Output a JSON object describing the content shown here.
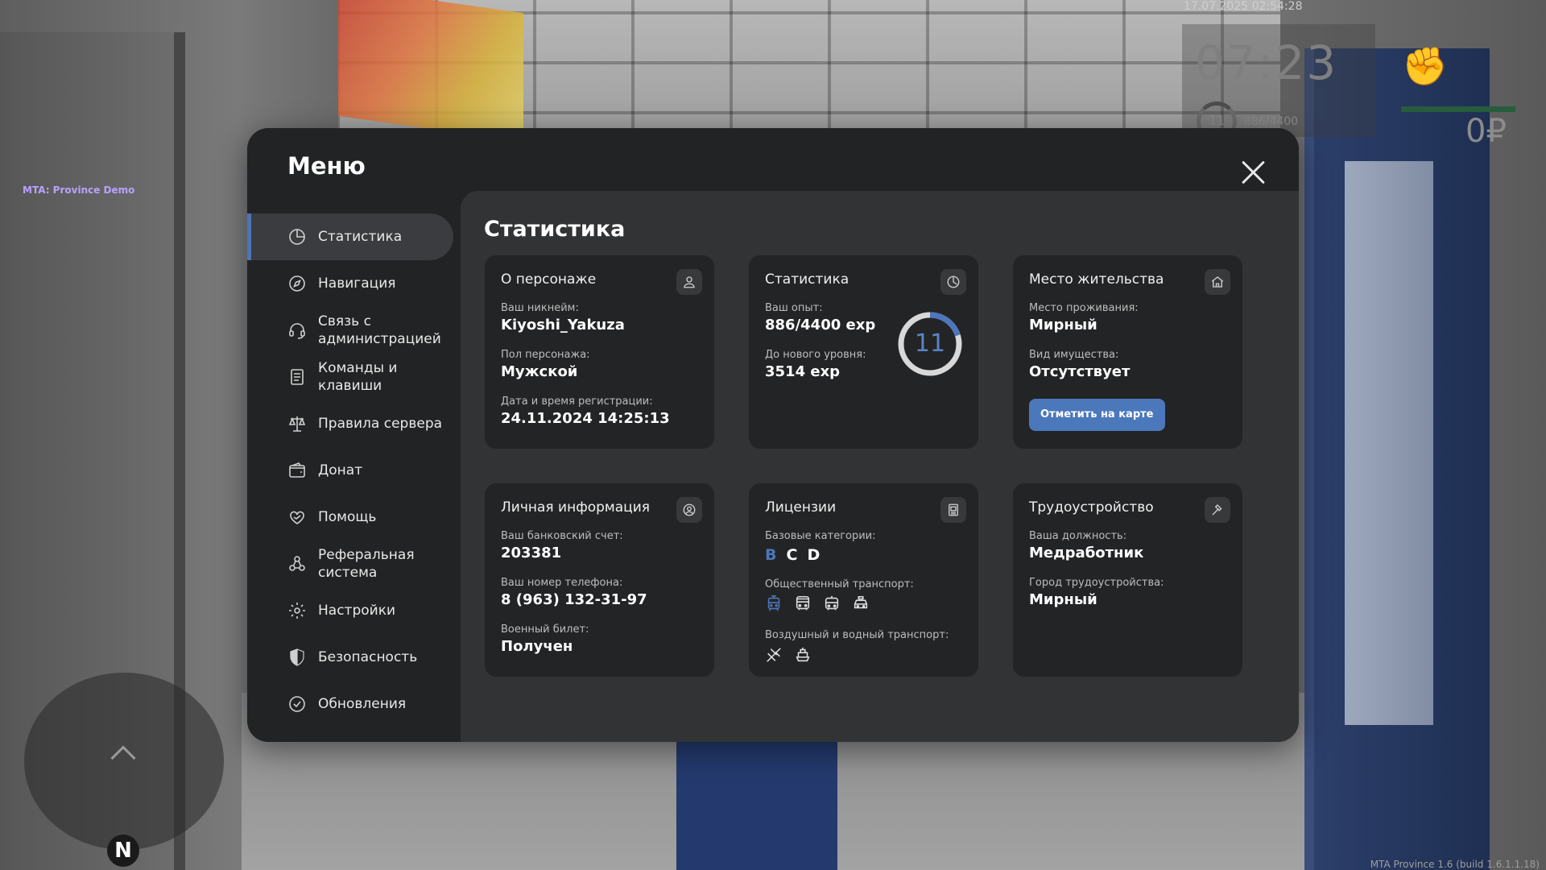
{
  "hud": {
    "datetime": "17.07.2025 02:54:28",
    "time": "07:23",
    "level": "11",
    "exp": "886/4400",
    "money": "0₽",
    "server": "MTA: Province Demo",
    "compass": "N",
    "build": "MTA Province 1.6 (build 1.6.1.1.18)"
  },
  "menu": {
    "title": "Меню",
    "sidebar": [
      {
        "label": "Статистика",
        "icon": "pie-chart-icon",
        "active": true
      },
      {
        "label": "Навигация",
        "icon": "compass-icon"
      },
      {
        "label": "Связь с\nадминистрацией",
        "icon": "headset-icon"
      },
      {
        "label": "Команды и\nклавиши",
        "icon": "document-list-icon"
      },
      {
        "label": "Правила сервера",
        "icon": "scales-icon"
      },
      {
        "label": "Донат",
        "icon": "wallet-icon"
      },
      {
        "label": "Помощь",
        "icon": "heart-hand-icon"
      },
      {
        "label": "Реферальная\nсистема",
        "icon": "referral-people-icon"
      },
      {
        "label": "Настройки",
        "icon": "gear-icon"
      },
      {
        "label": "Безопасность",
        "icon": "shield-icon"
      },
      {
        "label": "Обновления",
        "icon": "check-circle-icon"
      }
    ]
  },
  "content": {
    "title": "Статистика",
    "about": {
      "title": "О персонаже",
      "icon": "user-icon",
      "nickname_label": "Ваш никнейм:",
      "nickname": "Kiyoshi_Yakuza",
      "gender_label": "Пол персонажа:",
      "gender": "Мужской",
      "reg_label": "Дата и время регистрации:",
      "reg": "24.11.2024 14:25:13"
    },
    "stats": {
      "title": "Статистика",
      "icon": "clock-pie-icon",
      "exp_label": "Ваш опыт:",
      "exp": "886/4400 exp",
      "next_label": "До нового уровня:",
      "next": "3514 exp",
      "level": "11",
      "progress": 0.2014,
      "ring_color": "#4e77bb"
    },
    "residence": {
      "title": "Место жительства",
      "icon": "house-icon",
      "place_label": "Место проживания:",
      "place": "Мирный",
      "property_label": "Вид имущества:",
      "property": "Отсутствует",
      "button": "Отметить на карте"
    },
    "personal": {
      "title": "Личная информация",
      "icon": "user-circle-icon",
      "bank_label": "Ваш банковский счет:",
      "bank": "203381",
      "phone_label": "Ваш номер телефона:",
      "phone": "8 (963) 132-31-97",
      "military_label": "Военный билет:",
      "military": "Получен"
    },
    "licenses": {
      "title": "Лицензии",
      "icon": "id-card-icon",
      "base_label": "Базовые категории:",
      "categories": [
        {
          "name": "B",
          "active": true
        },
        {
          "name": "C",
          "active": false
        },
        {
          "name": "D",
          "active": false
        }
      ],
      "public_label": "Общественный транспорт:",
      "public_icons": [
        "tram-icon",
        "bus-icon",
        "trolleybus-icon",
        "taxi-icon"
      ],
      "air_label": "Воздушный и водный транспорт:",
      "air_icons": [
        "airplane-icon",
        "ship-icon"
      ]
    },
    "job": {
      "title": "Трудоустройство",
      "icon": "hammer-icon",
      "position_label": "Ваша должность:",
      "position": "Медработник",
      "city_label": "Город трудоустройства:",
      "city": "Мирный"
    }
  }
}
